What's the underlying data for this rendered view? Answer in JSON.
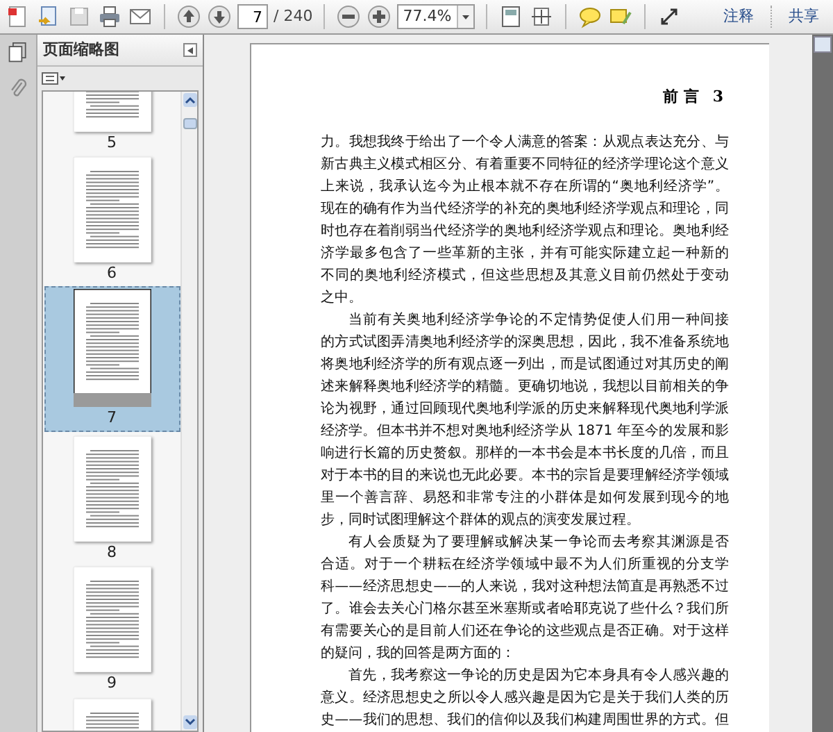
{
  "toolbar": {
    "page_field": {
      "value": "7"
    },
    "page_total": "/ 240",
    "zoom_field": {
      "value": "77.4%"
    },
    "right_buttons": [
      "注释",
      "共享"
    ]
  },
  "sidebar": {
    "title": "页面缩略图",
    "thumbnails": [
      {
        "label": "5",
        "selected": false
      },
      {
        "label": "6",
        "selected": false
      },
      {
        "label": "7",
        "selected": true
      },
      {
        "label": "8",
        "selected": false
      },
      {
        "label": "9",
        "selected": false
      }
    ]
  },
  "document": {
    "header": {
      "title": "前 言",
      "page_number": "3"
    },
    "paragraphs": [
      {
        "indent": false,
        "lines": [
          "力。我想我终于给出了一个令人满意的答案：从观点表达充分、与",
          "新古典主义模式相区分、有着重要不同特征的经济学理论这个意义",
          "上来说，我承认迄今为止根本就不存在所谓的“奥地利经济学”。",
          "现在的确有作为当代经济学的补充的奥地利经济学观点和理论，同",
          "时也存在着削弱当代经济学的奥地利经济学观点和理论。奥地利经",
          "济学最多包含了一些革新的主张，并有可能实际建立起一种新的",
          "不同的奥地利经济模式，但这些思想及其意义目前仍然处于变动",
          "之中。"
        ]
      },
      {
        "indent": true,
        "lines": [
          "当前有关奥地利经济学争论的不定情势促使人们用一种间接",
          "的方式试图弄清奥地利经济学的深奥思想，因此，我不准备系统地",
          "将奥地利经济学的所有观点逐一列出，而是试图通过对其历史的阐",
          "述来解释奥地利经济学的精髓。更确切地说，我想以目前相关的争",
          "论为视野，通过回顾现代奥地利学派的历史来解释现代奥地利学派",
          "经济学。但本书并不想对奥地利经济学从 1871 年至今的发展和影",
          "响进行长篇的历史赘叙。那样的一本书会是本书长度的几倍，而且",
          "对于本书的目的来说也无此必要。本书的宗旨是要理解经济学领域",
          "里一个善言辞、易怒和非常专注的小群体是如何发展到现今的地",
          "步，同时试图理解这个群体的观点的演变发展过程。"
        ]
      },
      {
        "indent": true,
        "lines": [
          "有人会质疑为了要理解或解决某一争论而去考察其渊源是否",
          "合适。对于一个耕耘在经济学领域中最不为人们所重视的分支学",
          "科——经济思想史——的人来说，我对这种想法简直是再熟悉不过",
          "了。谁会去关心门格尔甚至米塞斯或者哈耶克说了些什么？我们所",
          "有需要关心的是目前人们还在争论的这些观点是否正确。对于这样",
          "的疑问，我的回答是两方面的："
        ]
      },
      {
        "indent": true,
        "lines": [
          "首先，我考察这一争论的历史是因为它本身具有令人感兴趣的",
          "意义。经济思想史之所以令人感兴趣是因为它是关于我们人类的历",
          "史——我们的思想、我们的信仰以及我们构建周围世界的方式。但"
        ]
      }
    ]
  }
}
